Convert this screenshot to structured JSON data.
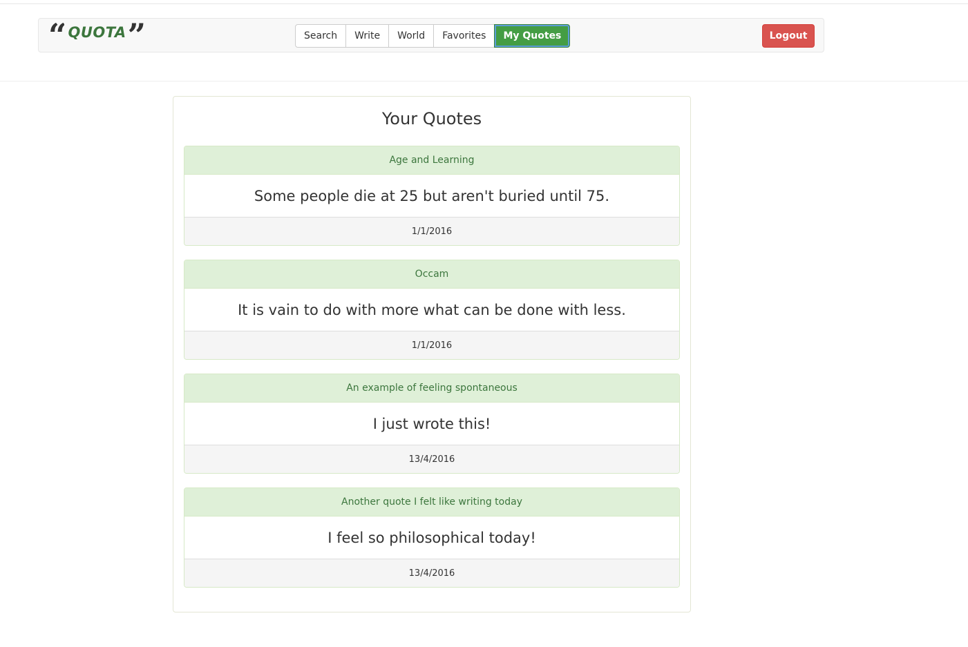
{
  "brand": {
    "open_quote": "“",
    "name": "QUOTA",
    "close_quote": "”"
  },
  "nav": {
    "items": [
      {
        "label": "Search"
      },
      {
        "label": "Write"
      },
      {
        "label": "World"
      },
      {
        "label": "Favorites"
      },
      {
        "label": "My Quotes",
        "active": true
      }
    ],
    "logout_label": "Logout"
  },
  "page": {
    "title": "Your Quotes"
  },
  "quotes": [
    {
      "topic": "Age and Learning",
      "text": "Some people die at 25 but aren't buried until 75.",
      "date": "1/1/2016"
    },
    {
      "topic": "Occam",
      "text": "It is vain to do with more what can be done with less.",
      "date": "1/1/2016"
    },
    {
      "topic": "An example of feeling spontaneous",
      "text": "I just wrote this!",
      "date": "13/4/2016"
    },
    {
      "topic": "Another quote I felt like writing today",
      "text": "I feel so philosophical today!",
      "date": "13/4/2016"
    }
  ],
  "colors": {
    "brand_green": "#3c763d",
    "active_button": "#449d44",
    "logout_red": "#d9534f",
    "card_header_bg": "#dff0d8",
    "card_footer_bg": "#f5f5f5"
  }
}
